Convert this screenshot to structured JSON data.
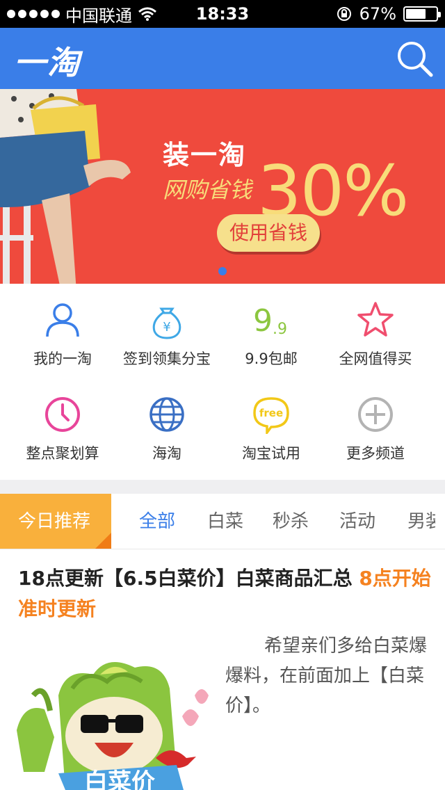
{
  "status_bar": {
    "carrier": "中国联通",
    "time": "18:33",
    "battery": "67%",
    "battery_level": 0.67
  },
  "app": {
    "logo": "一淘"
  },
  "banner": {
    "title": "装一淘",
    "subtitle": "网购省钱",
    "percent": "30%",
    "button": "使用省钱",
    "colors": {
      "background": "#ef4a3d",
      "accent": "#f8dc7a"
    }
  },
  "grid": {
    "items": [
      {
        "label": "我的一淘",
        "icon": "user-icon"
      },
      {
        "label": "签到领集分宝",
        "icon": "money-bag-icon"
      },
      {
        "label": "9.9包邮",
        "icon": "nine-nine-icon"
      },
      {
        "label": "全网值得买",
        "icon": "star-icon"
      },
      {
        "label": "整点聚划算",
        "icon": "clock-icon"
      },
      {
        "label": "海淘",
        "icon": "globe-icon"
      },
      {
        "label": "淘宝试用",
        "icon": "free-bubble-icon"
      },
      {
        "label": "更多频道",
        "icon": "plus-circle-icon"
      }
    ]
  },
  "tabs": {
    "today": "今日推荐",
    "items": [
      "全部",
      "白菜",
      "秒杀",
      "活动",
      "男装"
    ]
  },
  "article": {
    "title_main": "18点更新【6.5白菜价】白菜商品汇总 ",
    "title_highlight": "8点开始准时更新",
    "body": "希望亲们多给白菜爆爆料，在前面加上【白菜价】。",
    "thumb_label": "白菜价"
  },
  "colors": {
    "primary": "#3a7ee8",
    "orange": "#f58220",
    "tab_today": "#f9b03c"
  }
}
